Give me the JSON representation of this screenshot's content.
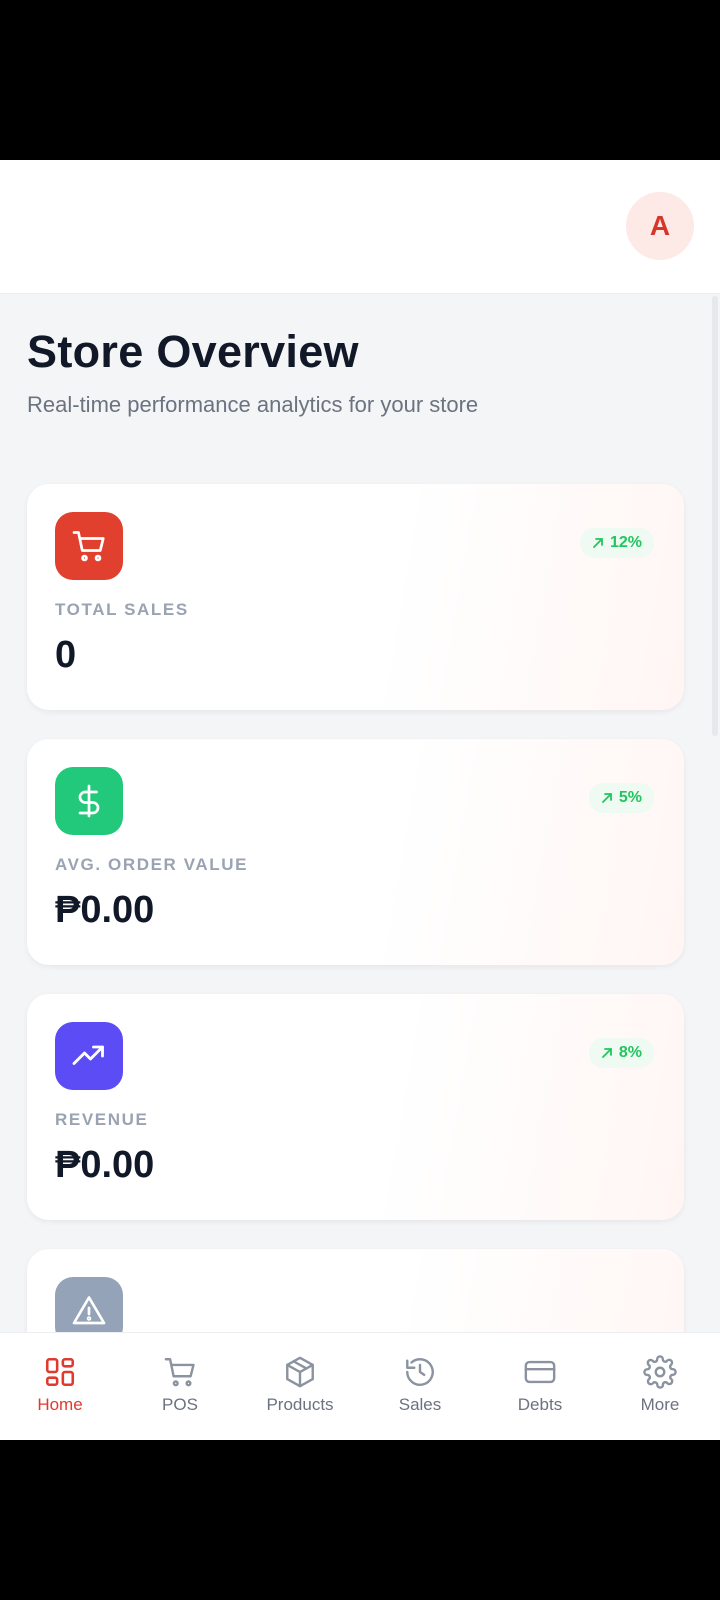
{
  "header": {
    "avatar_letter": "A"
  },
  "page": {
    "title": "Store Overview",
    "subtitle": "Real-time performance analytics for your store"
  },
  "cards": [
    {
      "label": "TOTAL SALES",
      "value": "0",
      "badge": "12%",
      "icon": "shopping-cart-icon",
      "color": "#e2402f"
    },
    {
      "label": "AVG. ORDER VALUE",
      "value": "₱0.00",
      "badge": "5%",
      "icon": "dollar-icon",
      "color": "#22c97a"
    },
    {
      "label": "REVENUE",
      "value": "₱0.00",
      "badge": "8%",
      "icon": "trending-up-icon",
      "color": "#5b4cf5"
    },
    {
      "icon": "warning-icon",
      "color": "#94a3b8"
    }
  ],
  "nav": [
    {
      "label": "Home",
      "icon": "grid-icon",
      "active": true
    },
    {
      "label": "POS",
      "icon": "cart-icon"
    },
    {
      "label": "Products",
      "icon": "box-icon"
    },
    {
      "label": "Sales",
      "icon": "history-icon"
    },
    {
      "label": "Debts",
      "icon": "card-icon"
    },
    {
      "label": "More",
      "icon": "gear-icon"
    }
  ],
  "colors": {
    "accent": "#e0392e",
    "positive": "#22c55e"
  }
}
